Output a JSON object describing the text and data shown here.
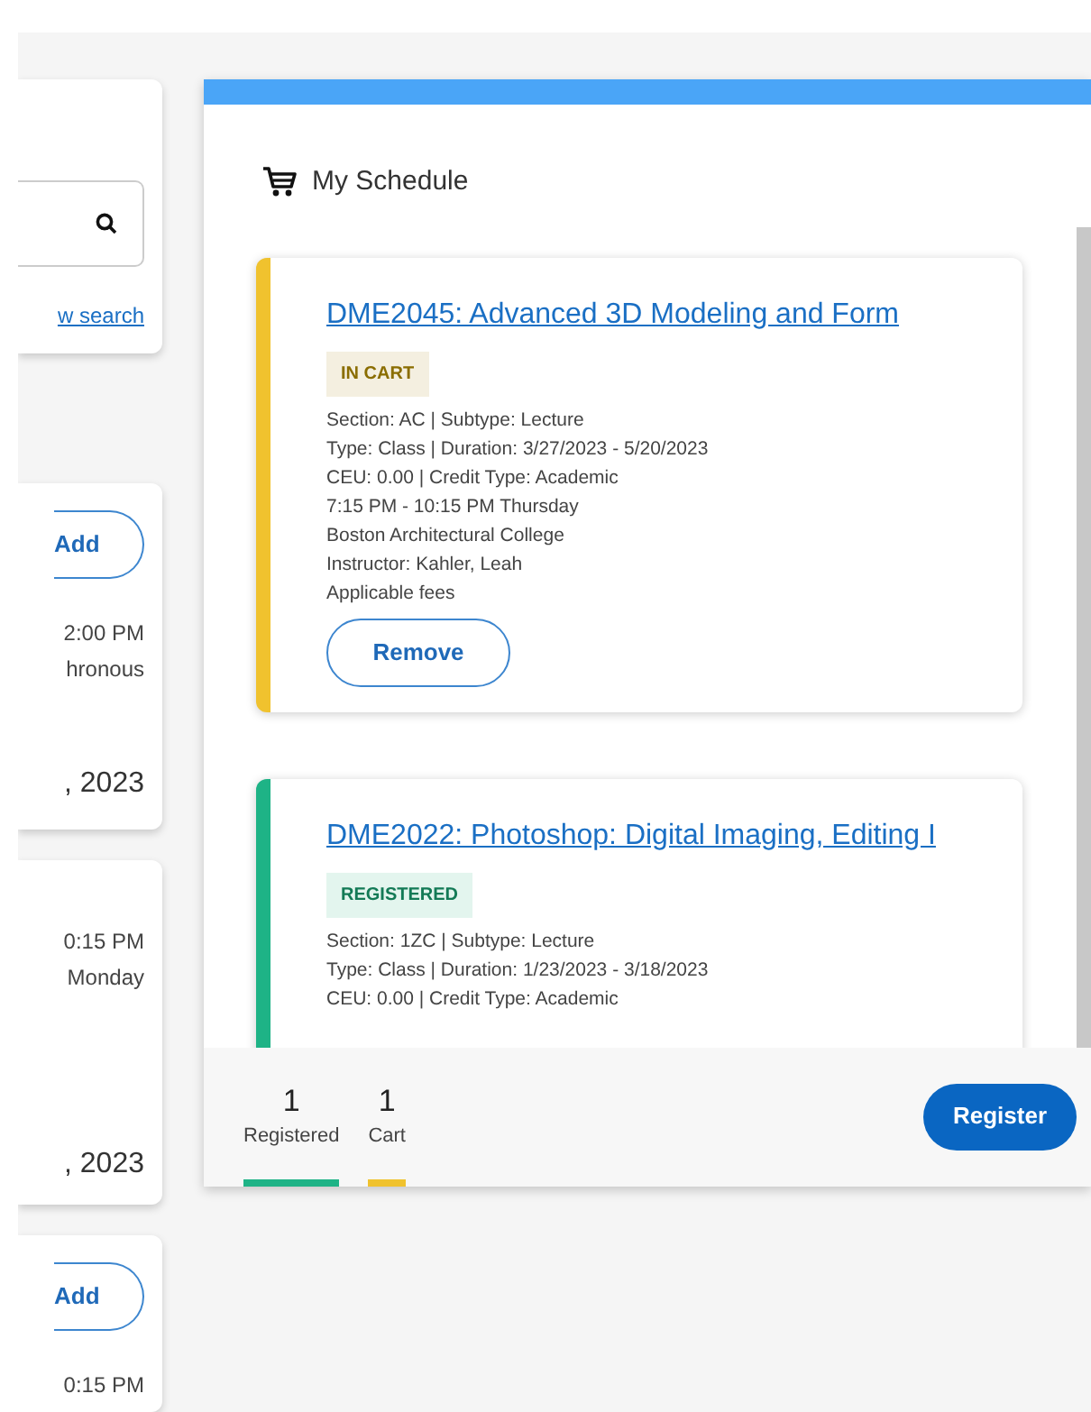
{
  "search_panel": {
    "link": "w search"
  },
  "side_cards": [
    {
      "button": "Add",
      "lines": [
        "2:00 PM",
        "hronous"
      ],
      "date": ", 2023"
    },
    {
      "lines": [
        "0:15 PM",
        "Monday"
      ],
      "date": ", 2023"
    },
    {
      "button": "Add",
      "lines": [
        "0:15 PM"
      ]
    }
  ],
  "schedule": {
    "title": "My Schedule",
    "courses": [
      {
        "kind": "cart",
        "title": "DME2045: Advanced 3D Modeling and Form",
        "status": "IN CART",
        "details": [
          "Section: AC | Subtype: Lecture",
          "Type: Class | Duration: 3/27/2023 - 5/20/2023",
          "CEU: 0.00 | Credit Type: Academic",
          "7:15 PM - 10:15 PM Thursday",
          "Boston Architectural College",
          "Instructor: Kahler, Leah",
          "Applicable fees"
        ],
        "button": "Remove"
      },
      {
        "kind": "registered",
        "title": "DME2022: Photoshop: Digital Imaging, Editing I",
        "status": "REGISTERED",
        "details": [
          "Section: 1ZC | Subtype: Lecture",
          "Type: Class | Duration: 1/23/2023 - 3/18/2023",
          "CEU: 0.00 | Credit Type: Academic"
        ]
      }
    ],
    "summary": [
      {
        "kind": "registered",
        "count": "1",
        "label": "Registered"
      },
      {
        "kind": "cart",
        "count": "1",
        "label": "Cart"
      }
    ],
    "register_button": "Register"
  }
}
